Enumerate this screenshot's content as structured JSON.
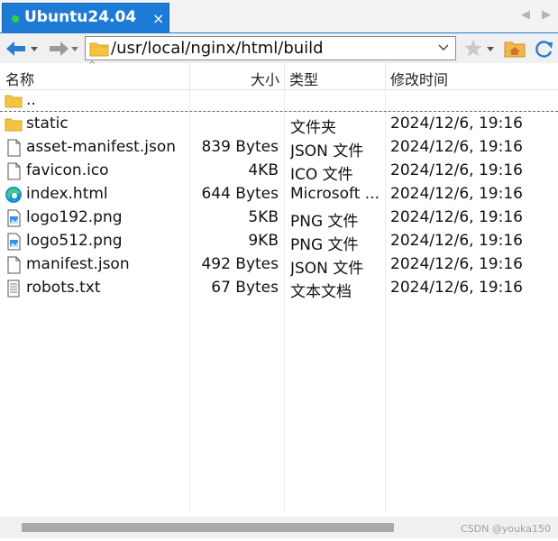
{
  "tab": {
    "title": "Ubuntu24.04",
    "close_glyph": "×",
    "status_color": "#35d04b"
  },
  "tabnav": {
    "left_glyph": "◀",
    "right_glyph": "▶"
  },
  "toolbar": {
    "path": "/usr/local/nginx/html/build",
    "icons": [
      "back-arrow-icon",
      "forward-arrow-icon",
      "folder-icon",
      "chevron-down-icon",
      "star-icon",
      "home-folder-icon",
      "refresh-icon"
    ]
  },
  "columns": {
    "name": "名称",
    "size": "大小",
    "type": "类型",
    "modified": "修改时间"
  },
  "parent_dir": {
    "name": ".."
  },
  "files": [
    {
      "name": "static",
      "size": "",
      "type": "文件夹",
      "modified": "2024/12/6, 19:16",
      "icon": "folder"
    },
    {
      "name": "asset-manifest.json",
      "size": "839 Bytes",
      "type": "JSON 文件",
      "modified": "2024/12/6, 19:16",
      "icon": "file"
    },
    {
      "name": "favicon.ico",
      "size": "4KB",
      "type": "ICO 文件",
      "modified": "2024/12/6, 19:16",
      "icon": "file"
    },
    {
      "name": "index.html",
      "size": "644 Bytes",
      "type": "Microsoft ...",
      "modified": "2024/12/6, 19:16",
      "icon": "edge"
    },
    {
      "name": "logo192.png",
      "size": "5KB",
      "type": "PNG 文件",
      "modified": "2024/12/6, 19:16",
      "icon": "image"
    },
    {
      "name": "logo512.png",
      "size": "9KB",
      "type": "PNG 文件",
      "modified": "2024/12/6, 19:16",
      "icon": "image"
    },
    {
      "name": "manifest.json",
      "size": "492 Bytes",
      "type": "JSON 文件",
      "modified": "2024/12/6, 19:16",
      "icon": "file"
    },
    {
      "name": "robots.txt",
      "size": "67 Bytes",
      "type": "文本文档",
      "modified": "2024/12/6, 19:16",
      "icon": "text"
    }
  ],
  "watermark": "CSDN @youka150",
  "colors": {
    "accent": "#1d7bd6",
    "folder": "#f5c242"
  }
}
